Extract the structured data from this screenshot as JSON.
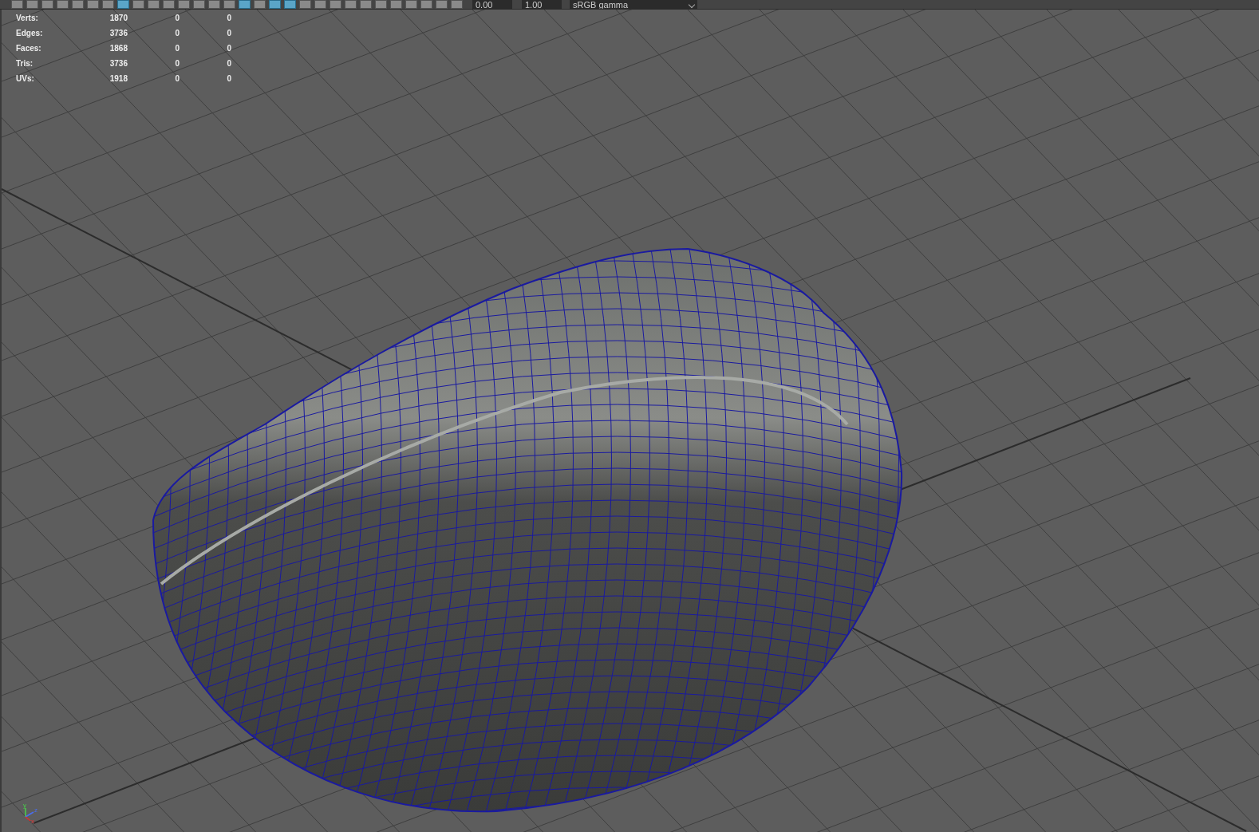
{
  "toolbar": {
    "buttons": [
      {
        "selected": false
      },
      {
        "selected": false
      },
      {
        "selected": false
      },
      {
        "selected": false
      },
      {
        "selected": false
      },
      {
        "selected": false
      },
      {
        "selected": false
      },
      {
        "selected": true
      },
      {
        "selected": false
      },
      {
        "selected": false
      },
      {
        "selected": false
      },
      {
        "selected": false
      },
      {
        "selected": false
      },
      {
        "selected": false
      },
      {
        "selected": false
      },
      {
        "selected": true
      },
      {
        "selected": false
      },
      {
        "selected": true
      },
      {
        "selected": true
      },
      {
        "selected": false
      },
      {
        "selected": false
      },
      {
        "selected": false
      },
      {
        "selected": false
      },
      {
        "selected": false
      },
      {
        "selected": false
      },
      {
        "selected": false
      },
      {
        "selected": false
      },
      {
        "selected": false
      },
      {
        "selected": false
      },
      {
        "selected": false
      }
    ],
    "fields": [
      {
        "value": "0.00"
      },
      {
        "value": "1.00"
      }
    ],
    "color_space": "sRGB gamma"
  },
  "hud_stats": [
    {
      "label": "Verts:",
      "values": [
        "1870",
        "0",
        "0"
      ]
    },
    {
      "label": "Edges:",
      "values": [
        "3736",
        "0",
        "0"
      ]
    },
    {
      "label": "Faces:",
      "values": [
        "1868",
        "0",
        "0"
      ]
    },
    {
      "label": "Tris:",
      "values": [
        "3736",
        "0",
        "0"
      ]
    },
    {
      "label": "UVs:",
      "values": [
        "1918",
        "0",
        "0"
      ]
    }
  ],
  "axis_labels": [
    "y",
    "z",
    "x"
  ]
}
